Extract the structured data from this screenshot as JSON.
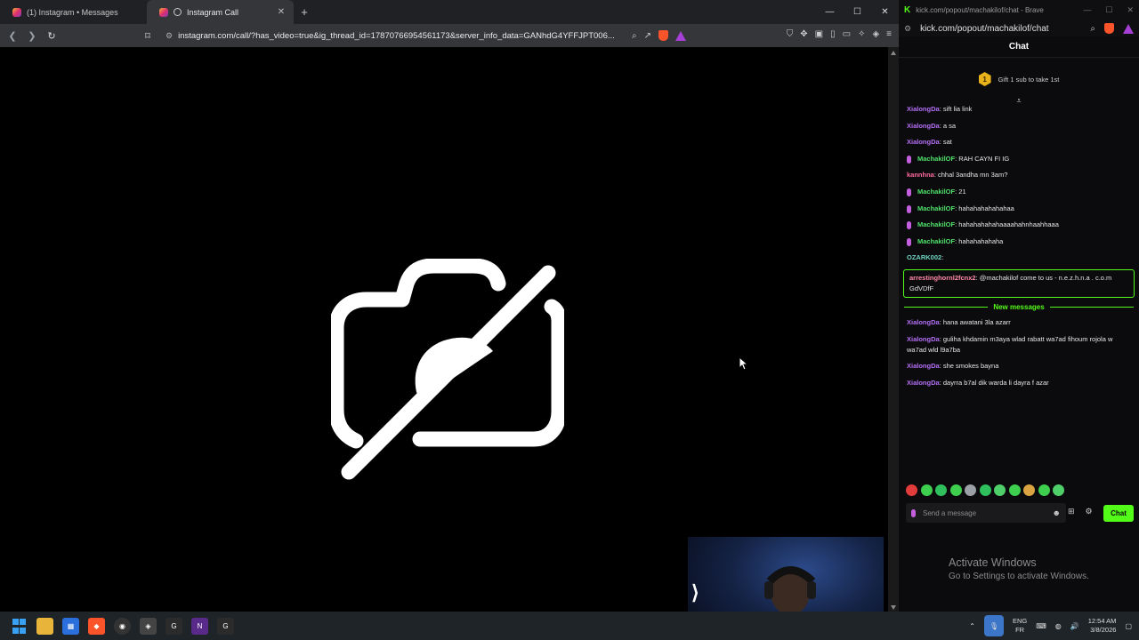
{
  "left_browser": {
    "tabs": [
      {
        "title": "(1) Instagram • Messages",
        "active": false
      },
      {
        "title": "Instagram Call",
        "active": true
      }
    ],
    "url": "instagram.com/call/?has_video=true&ig_thread_id=17870766954561173&server_info_data=GANhdG4YFFJPT006...",
    "shields_count": "1"
  },
  "call": {
    "camera_state": "camera-off"
  },
  "chat_window": {
    "window_title": "kick.com/popout/machakilof/chat - Brave",
    "address": "kick.com/popout/machakilof/chat",
    "header": "Chat",
    "gift_badge": "1",
    "gift_text": "Gift 1 sub to take 1st",
    "messages_before": [
      {
        "user": "XialongDa",
        "text": ": sift lia link",
        "color": "#b46ff5",
        "mic": false
      },
      {
        "user": "XialongDa",
        "text": ": a sa",
        "color": "#b46ff5",
        "mic": false
      },
      {
        "user": "XialongDa",
        "text": ": sat",
        "color": "#b46ff5",
        "mic": false
      },
      {
        "user": "MachakilOF",
        "text": ": RAH CAYN FI IG",
        "color": "#4fe06a",
        "mic": true
      },
      {
        "user": "kannhna",
        "text": ": chhal 3andha mn 3am?",
        "color": "#ff6b9c",
        "mic": false
      },
      {
        "user": "MachakilOF",
        "text": ": 21",
        "color": "#4fe06a",
        "mic": true
      },
      {
        "user": "MachakilOF",
        "text": ": hahahahahahahaa",
        "color": "#4fe06a",
        "mic": true
      },
      {
        "user": "MachakilOF",
        "text": ": hahahahahahaaaahahnhaahhaaa",
        "color": "#4fe06a",
        "mic": true
      },
      {
        "user": "MachakilOF",
        "text": ": hahahahahaha",
        "color": "#4fe06a",
        "mic": true
      },
      {
        "user": "OZARK002",
        "text": ": ",
        "color": "#6fd3c2",
        "mic": false
      }
    ],
    "highlight": {
      "user": "arrestinghornl2fcnx2",
      "text": ": @machakilof come to us - n.e.z.h.n.a . c.o.m GdVDfF",
      "color": "#ff8aa8"
    },
    "new_messages_label": "New messages",
    "messages_after": [
      {
        "user": "XialongDa",
        "text": ": hana awatani 3la azarr",
        "color": "#b46ff5"
      },
      {
        "user": "XialongDa",
        "text": ": guliha khdamin m3aya wlad rabatt wa7ad fihoum rojola w wa7ad wld l9a7ba",
        "color": "#b46ff5"
      },
      {
        "user": "XialongDa",
        "text": ": she smokes bayna",
        "color": "#b46ff5"
      },
      {
        "user": "XialongDa",
        "text": ": dayrra b7al dik warda li dayra f azar",
        "color": "#b46ff5"
      }
    ],
    "input_placeholder": "Send a message",
    "send_label": "Chat",
    "emote_colors": [
      "#e23b3b",
      "#3fcf4e",
      "#2fbf5c",
      "#3fcf4e",
      "#9aa0a6",
      "#2fbf5c",
      "#4fcf6a",
      "#3fcf4e",
      "#d9a441",
      "#3fcf4e",
      "#4fcf6a"
    ]
  },
  "watermark": {
    "line1": "Activate Windows",
    "line2": "Go to Settings to activate Windows."
  },
  "taskbar": {
    "lang_top": "ENG",
    "lang_bottom": "FR",
    "time": "12:54 AM",
    "date": "3/8/2026"
  },
  "colors": {
    "kick_green": "#53fc18",
    "accent_blue": "#3aa0f3"
  }
}
